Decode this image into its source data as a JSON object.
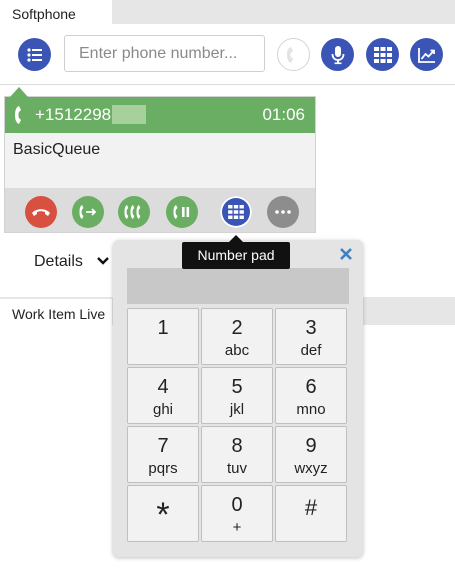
{
  "tab": {
    "title": "Softphone"
  },
  "toolbar": {
    "input_placeholder": "Enter phone number...",
    "input_value": "",
    "icons": [
      "queue-list-icon",
      "phone-icon",
      "microphone-icon",
      "keypad-icon",
      "chart-icon"
    ]
  },
  "call": {
    "number": "+1512298",
    "timer": "01:06",
    "queue": "BasicQueue",
    "actions": [
      "hangup",
      "transfer",
      "conference",
      "hold",
      "number-pad",
      "more"
    ]
  },
  "details": {
    "label": "Details"
  },
  "work_item": {
    "tab_title": "Work Item Live"
  },
  "tooltip": {
    "text": "Number pad"
  },
  "numpad": {
    "display_value": "",
    "keys": [
      {
        "digit": "1",
        "letters": ""
      },
      {
        "digit": "2",
        "letters": "abc"
      },
      {
        "digit": "3",
        "letters": "def"
      },
      {
        "digit": "4",
        "letters": "ghi"
      },
      {
        "digit": "5",
        "letters": "jkl"
      },
      {
        "digit": "6",
        "letters": "mno"
      },
      {
        "digit": "7",
        "letters": "pqrs"
      },
      {
        "digit": "8",
        "letters": "tuv"
      },
      {
        "digit": "9",
        "letters": "wxyz"
      },
      {
        "digit": "*",
        "letters": ""
      },
      {
        "digit": "0",
        "letters": "+"
      },
      {
        "digit": "#",
        "letters": ""
      }
    ]
  },
  "colors": {
    "primary_blue": "#3a55b5",
    "call_green": "#6aae63",
    "hangup_red": "#d8503f",
    "more_grey": "#8d8d8d",
    "close_blue": "#3f7fc4"
  }
}
